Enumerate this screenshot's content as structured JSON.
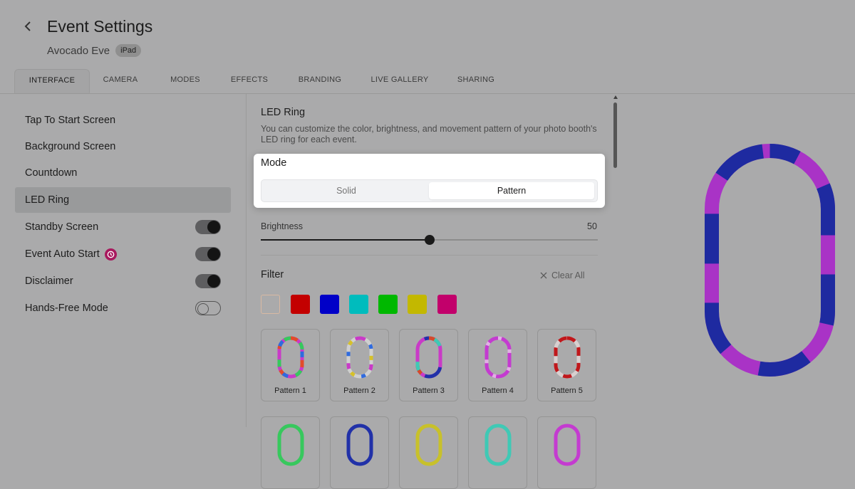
{
  "header": {
    "back_label": "",
    "title": "Event Settings",
    "event_name": "Avocado Eve",
    "device_badge": "iPad"
  },
  "tabs": [
    {
      "label": "INTERFACE",
      "active": true
    },
    {
      "label": "CAMERA",
      "active": false
    },
    {
      "label": "MODES",
      "active": false
    },
    {
      "label": "EFFECTS",
      "active": false
    },
    {
      "label": "BRANDING",
      "active": false
    },
    {
      "label": "LIVE GALLERY",
      "active": false
    },
    {
      "label": "SHARING",
      "active": false
    }
  ],
  "sidebar": {
    "items": [
      {
        "label": "Tap To Start Screen",
        "active": false
      },
      {
        "label": "Background Screen",
        "active": false
      },
      {
        "label": "Countdown",
        "active": false
      },
      {
        "label": "LED Ring",
        "active": true
      },
      {
        "label": "Standby Screen",
        "toggle": "on"
      },
      {
        "label": "Event Auto Start",
        "toggle": "on",
        "icon": "clock-icon"
      },
      {
        "label": "Disclaimer",
        "toggle": "on"
      },
      {
        "label": "Hands-Free Mode",
        "toggle": "off"
      }
    ]
  },
  "led_ring": {
    "title": "LED Ring",
    "description": "You can customize the color, brightness, and movement pattern of your photo booth's LED ring for each event.",
    "mode": {
      "title": "Mode",
      "options": [
        "Solid",
        "Pattern"
      ],
      "selected": "Pattern"
    },
    "brightness": {
      "label": "Brightness",
      "value": "50",
      "level": 0.5
    },
    "filter": {
      "title": "Filter",
      "clear_label": "Clear All",
      "swatches": [
        "#f4ece4",
        "#c30000",
        "#0000c8",
        "#00bcbd",
        "#00b800",
        "#c3b800",
        "#c2006b"
      ]
    },
    "patterns": [
      {
        "label": "Pattern 1"
      },
      {
        "label": "Pattern 2"
      },
      {
        "label": "Pattern 3"
      },
      {
        "label": "Pattern 4"
      },
      {
        "label": "Pattern 5"
      }
    ]
  },
  "colors": {
    "accent": "#a8195e",
    "preview_purple": "#a933c6",
    "preview_blue": "#1e2aa0"
  }
}
